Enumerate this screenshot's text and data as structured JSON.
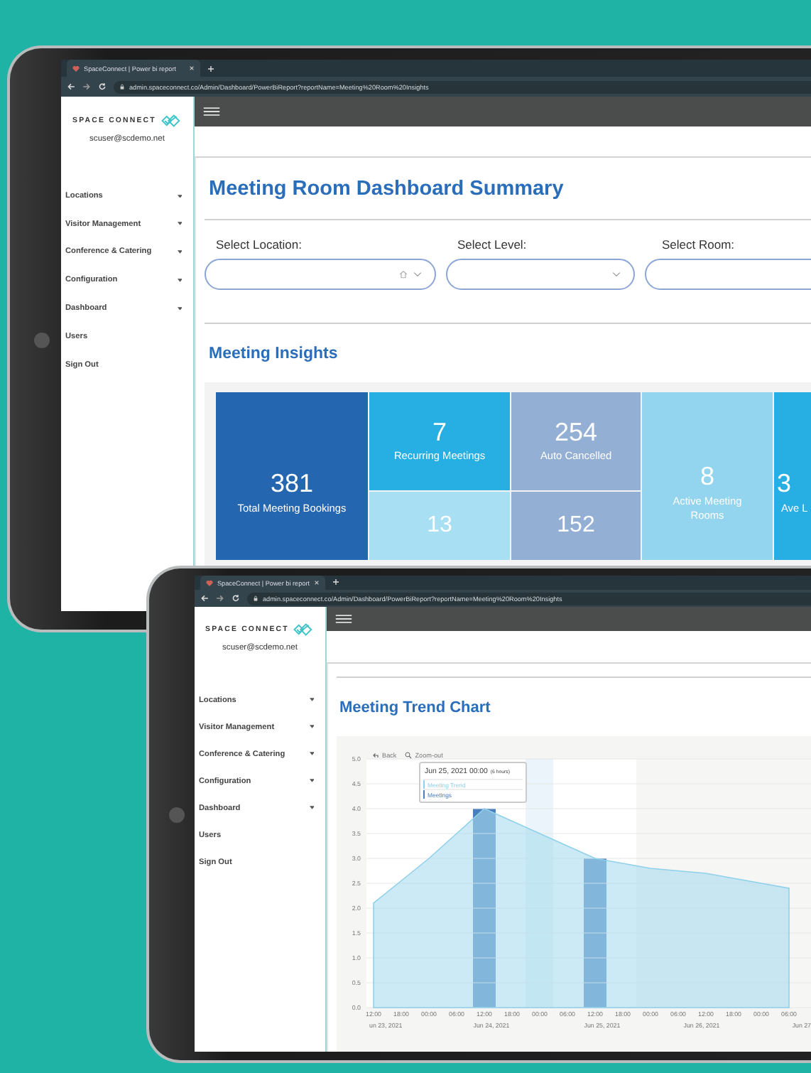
{
  "tablets": [
    {
      "browser": {
        "tab_title": "SpaceConnect | Power bi report",
        "url": "admin.spaceconnect.co/Admin/Dashboard/PowerBiReport?reportName=Meeting%20Room%20Insights"
      },
      "sidebar": {
        "brand": "SPACE CONNECT",
        "user": "scuser@scdemo.net",
        "items": [
          {
            "label": "Locations",
            "expandable": true
          },
          {
            "label": "Visitor Management",
            "expandable": true
          },
          {
            "label": "Conference & Catering",
            "expandable": true
          },
          {
            "label": "Configuration",
            "expandable": true
          },
          {
            "label": "Dashboard",
            "expandable": true
          },
          {
            "label": "Users",
            "expandable": false
          },
          {
            "label": "Sign Out",
            "expandable": false
          }
        ]
      },
      "page": {
        "kind": "summary",
        "title": "Meeting Room Dashboard Summary",
        "filters": [
          {
            "label": "Select Location:"
          },
          {
            "label": "Select Level:"
          },
          {
            "label": "Select Room:"
          }
        ],
        "section_title": "Meeting Insights",
        "tile_columns": [
          {
            "tiles": [
              {
                "value": "381",
                "label": "Total Meeting Bookings",
                "color": "#2566b0"
              }
            ]
          },
          {
            "tiles": [
              {
                "value": "7",
                "label": "Recurring Meetings",
                "color": "#27aee3"
              },
              {
                "value": "13",
                "color": "#a8dff2"
              }
            ]
          },
          {
            "tiles": [
              {
                "value": "254",
                "label": "Auto Cancelled",
                "color": "#94afd4"
              },
              {
                "value": "152",
                "color": "#94afd4"
              }
            ]
          },
          {
            "tiles": [
              {
                "value": "8",
                "label": "Active Meeting Rooms",
                "color": "#93d5ee"
              }
            ]
          },
          {
            "tiles": [
              {
                "value": "3",
                "label": "Ave L",
                "color": "#27aee3"
              }
            ]
          }
        ]
      }
    },
    {
      "browser": {
        "tab_title": "SpaceConnect | Power bi report",
        "url": "admin.spaceconnect.co/Admin/Dashboard/PowerBiReport?reportName=Meeting%20Room%20Insights"
      },
      "sidebar": {
        "brand": "SPACE CONNECT",
        "user": "scuser@scdemo.net",
        "items": [
          {
            "label": "Locations",
            "expandable": true
          },
          {
            "label": "Visitor Management",
            "expandable": true
          },
          {
            "label": "Conference & Catering",
            "expandable": true
          },
          {
            "label": "Configuration",
            "expandable": true
          },
          {
            "label": "Dashboard",
            "expandable": true
          },
          {
            "label": "Users",
            "expandable": false
          },
          {
            "label": "Sign Out",
            "expandable": false
          }
        ]
      },
      "page": {
        "kind": "chart",
        "title": "Meeting Trend Chart",
        "chart": {
          "toolbar": [
            "Back",
            "Zoom-out"
          ],
          "tooltip": {
            "title": "Jun 25, 2021 00:00",
            "note": "(6 hours)"
          },
          "dates": [
            "un 23, 2021",
            "Jun 24, 2021",
            "Jun 25, 2021",
            "Jun 26, 2021",
            "Jun 27"
          ],
          "layers": [
            {
              "chart_data": {
                "type": "bar",
                "categories": [
                  "12:00",
                  "18:00",
                  "00:00",
                  "06:00",
                  "12:00",
                  "18:00",
                  "00:00",
                  "06:00",
                  "12:00",
                  "18:00",
                  "00:00",
                  "06:00",
                  "12:00",
                  "18:00",
                  "00:00",
                  "06:00"
                ],
                "series": [
                  {
                    "name": "Meetings",
                    "color": "#4a7fbf",
                    "values": [
                      null,
                      null,
                      null,
                      null,
                      4.0,
                      null,
                      null,
                      null,
                      3.0,
                      null,
                      null,
                      null,
                      null,
                      null,
                      null,
                      null
                    ]
                  }
                ],
                "ylim": [
                  0,
                  5
                ]
              }
            },
            {
              "chart_data": {
                "type": "area",
                "series": [
                  {
                    "name": "Meeting Trend",
                    "color": "#8fd0ea",
                    "values": [
                      2.1,
                      2.55,
                      3.0,
                      3.5,
                      4.0,
                      3.75,
                      3.5,
                      3.25,
                      3.0,
                      2.9,
                      2.8,
                      2.75,
                      2.7,
                      2.6,
                      2.5,
                      2.4
                    ]
                  }
                ],
                "ylim": [
                  0,
                  5
                ],
                "grid": true,
                "yticks": [
                  {
                    "value": 0,
                    "label": "0.0"
                  },
                  {
                    "value": 0.5,
                    "label": "0.5"
                  },
                  {
                    "value": 1,
                    "label": "1.0"
                  },
                  {
                    "value": 1.5,
                    "label": "1.5"
                  },
                  {
                    "value": 2,
                    "label": "2.0"
                  },
                  {
                    "value": 2.5,
                    "label": "2.5"
                  },
                  {
                    "value": 3,
                    "label": "3.0"
                  },
                  {
                    "value": 3.5,
                    "label": "3.5"
                  },
                  {
                    "value": 4,
                    "label": "4.0"
                  },
                  {
                    "value": 4.5,
                    "label": "4.5"
                  },
                  {
                    "value": 5,
                    "label": "5.0"
                  }
                ]
              }
            }
          ]
        }
      }
    }
  ]
}
